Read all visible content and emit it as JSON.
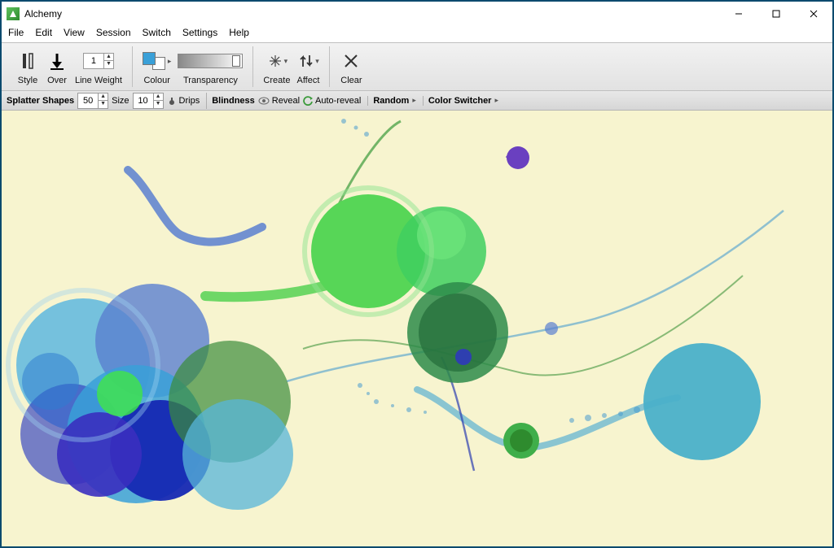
{
  "window": {
    "title": "Alchemy",
    "controls": {
      "min": "min",
      "max": "max",
      "close": "close"
    }
  },
  "menu": [
    "File",
    "Edit",
    "View",
    "Session",
    "Switch",
    "Settings",
    "Help"
  ],
  "toolbar": {
    "style": "Style",
    "over": "Over",
    "line_weight": "Line Weight",
    "line_weight_value": "1",
    "colour": "Colour",
    "transparency": "Transparency",
    "create": "Create",
    "affect": "Affect",
    "clear": "Clear"
  },
  "subtoolbar": {
    "splatter_shapes": "Splatter Shapes",
    "splatter_value": "50",
    "size_label": "Size",
    "size_value": "10",
    "drips": "Drips",
    "blindness": "Blindness",
    "reveal": "Reveal",
    "auto_reveal": "Auto-reveal",
    "random": "Random",
    "color_switcher": "Color Switcher"
  },
  "colors": {
    "canvas_bg": "#f7f4cf",
    "accent_fg": "#3aa0d8"
  }
}
